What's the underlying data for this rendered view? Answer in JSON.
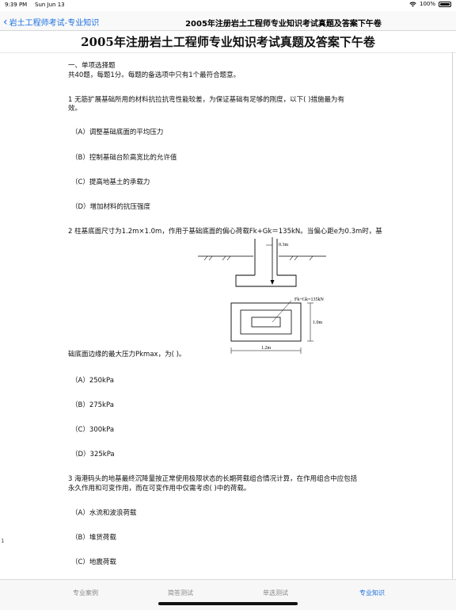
{
  "status": {
    "time": "9:39 PM",
    "date": "Sun Jun 13",
    "battery": "100%"
  },
  "nav": {
    "back_label": "岩土工程师考试-专业知识",
    "title": "2005年注册岩土工程师专业知识考试真题及答案下午卷"
  },
  "doc": {
    "title": "2005年注册岩土工程师专业知识考试真题及答案下午卷",
    "section": "一、单项选择题",
    "instructions": "共40题，每题1分。每题的备选项中只有1个最符合题意。",
    "q1": {
      "line1": "1 无筋扩展基础所用的材料抗拉抗弯性能较差，为保证基础有足够的刚度，以下(      )措施最为有",
      "line2": "效。",
      "options": [
        "（A）调整基础底面的平均压力",
        "（B）控制基础台阶高宽比的允许值",
        "（C）提高地基土的承载力",
        "（D）增加材料的抗压强度"
      ]
    },
    "q2": {
      "line1": "2 柱基底面尺寸为1.2m×1.0m，作用于基础底面的偏心荷载Fk+Gk＝135kN。当偏心距e为0.3m时，基",
      "line2": "础底面边缘的最大压力Pkmax，为( )。",
      "options": [
        "（A）250kPa",
        "（B）275kPa",
        "（C）300kPa",
        "（D）325kPa"
      ],
      "figure": {
        "eccentricity_label": "0.3m",
        "load_label": "Fk+Gk=135kN",
        "width_label": "1.2m",
        "depth_label": "1.0m"
      }
    },
    "q3": {
      "line1": "3 海港码头的地基最终沉降量按正常使用极限状态的长期荷载组合情况计算，在作用组合中应包括",
      "line2": "永久作用和可变作用，而在可变作用中仅需考虑(      )中的荷载。",
      "options": [
        "（A）水流和波浪荷载",
        "（B）堆货荷载",
        "（C）地震荷载"
      ]
    },
    "margin_mark": "1"
  },
  "tabs": [
    {
      "label": "专业案例",
      "active": false
    },
    {
      "label": "简答测试",
      "active": false
    },
    {
      "label": "单选测试",
      "active": false
    },
    {
      "label": "专业知识",
      "active": true
    }
  ],
  "colors": {
    "accent": "#1a6fe0",
    "tab_inactive": "#888888"
  }
}
